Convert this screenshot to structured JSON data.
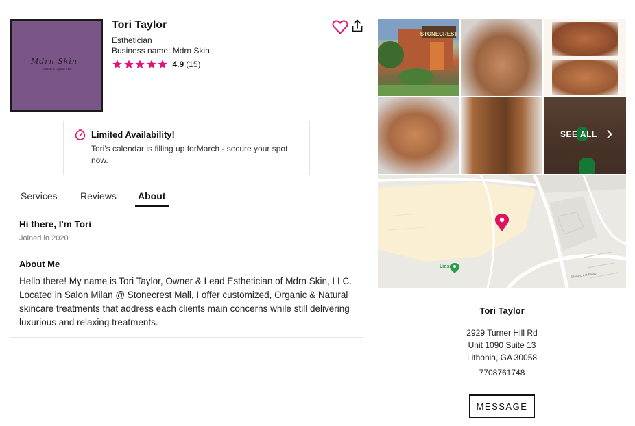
{
  "profile": {
    "name": "Tori Taylor",
    "profession": "Esthetician",
    "business_label": "Business name:",
    "business_name": "Mdrn Skin",
    "rating": "4.9",
    "review_count": "(15)",
    "stars": 5,
    "logo": {
      "script": "Mdrn Skin",
      "tagline": "Natural & Organic Care",
      "background": "#7a5587"
    },
    "accent_color": "#e5127a"
  },
  "actions": {
    "favorite_icon": "heart-icon",
    "share_icon": "share-icon"
  },
  "availability": {
    "icon": "timer-icon",
    "title": "Limited Availability!",
    "message": "Tori's calendar is filling up forMarch - secure your spot now."
  },
  "tabs": [
    {
      "label": "Services",
      "active": false
    },
    {
      "label": "Reviews",
      "active": false
    },
    {
      "label": "About",
      "active": true
    }
  ],
  "about": {
    "greeting": "Hi there, I'm Tori",
    "joined": "Joined in 2020",
    "heading": "About Me",
    "body": "Hello there! My name is Tori Taylor, Owner & Lead Esthetician of Mdrn Skin, LLC. Located in Salon Milan @ Stonecrest Mall, I offer customized, Organic & Natural skincare treatments that address each clients main concerns while still delivering luxurious and relaxing treatments."
  },
  "gallery": {
    "see_all": "SEE ALL",
    "storefront_sign": "STONECREST"
  },
  "map": {
    "pin_color": "#e0115f",
    "poi_label": "Lids",
    "street_label": "Stonecrest Pkwy"
  },
  "location": {
    "name": "Tori Taylor",
    "address_line1": "2929 Turner Hill Rd",
    "address_line2": "Unit 1090 Suite 13",
    "address_line3": "Lithonia, GA 30058",
    "phone": "7708761748",
    "message_button": "MESSAGE"
  }
}
